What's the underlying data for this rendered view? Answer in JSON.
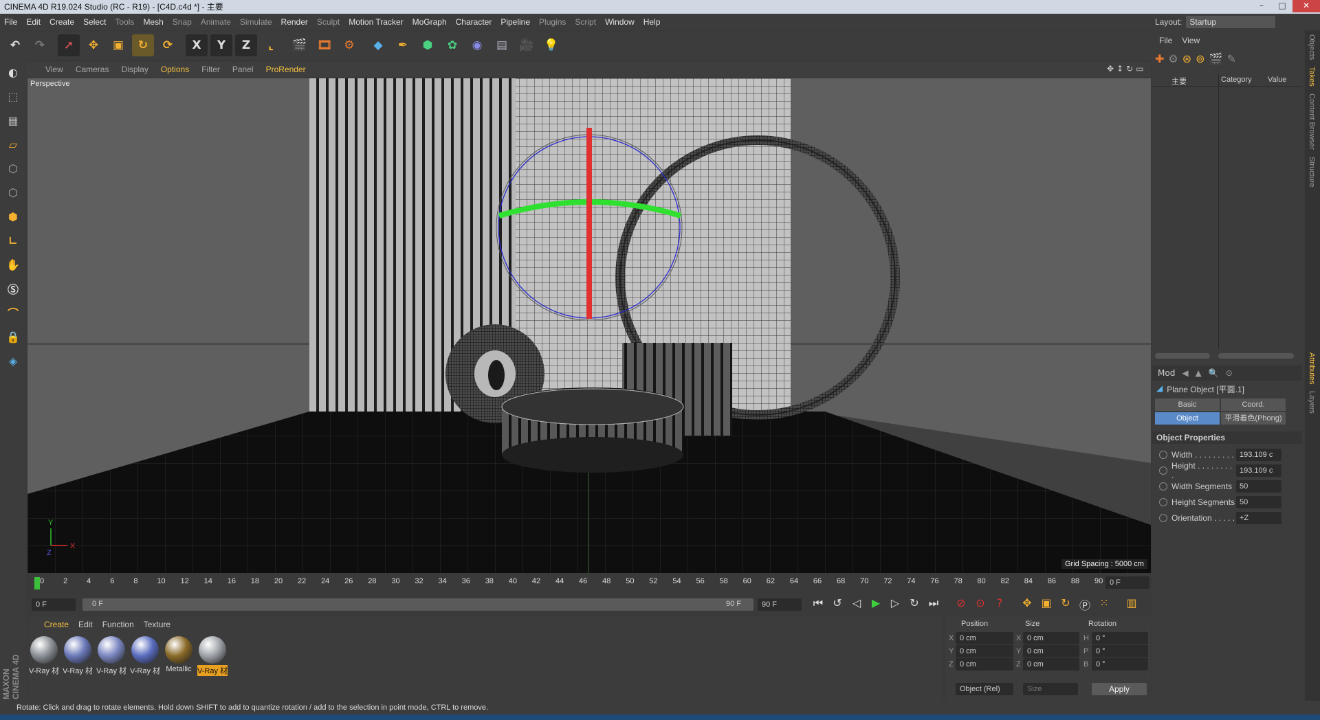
{
  "title_bar": {
    "title": "CINEMA 4D R19.024 Studio (RC - R19) - [C4D.c4d *] - 主要"
  },
  "menu": [
    "File",
    "Edit",
    "Create",
    "Select",
    "Tools",
    "Mesh",
    "Snap",
    "Animate",
    "Simulate",
    "Render",
    "Sculpt",
    "Motion Tracker",
    "MoGraph",
    "Character",
    "Pipeline",
    "Plugins",
    "Script",
    "Window",
    "Help"
  ],
  "layout": {
    "label": "Layout:",
    "value": "Startup"
  },
  "viewport": {
    "menu": [
      "View",
      "Cameras",
      "Display",
      "Options",
      "Filter",
      "Panel",
      "ProRender"
    ],
    "name": "Perspective",
    "grid_spacing": "Grid Spacing : 5000 cm"
  },
  "timeline": {
    "ticks": [
      "0",
      "2",
      "4",
      "6",
      "8",
      "10",
      "12",
      "14",
      "16",
      "18",
      "20",
      "22",
      "24",
      "26",
      "28",
      "30",
      "32",
      "34",
      "36",
      "38",
      "40",
      "42",
      "44",
      "46",
      "48",
      "50",
      "52",
      "54",
      "56",
      "58",
      "60",
      "62",
      "64",
      "66",
      "68",
      "70",
      "72",
      "74",
      "76",
      "78",
      "80",
      "82",
      "84",
      "86",
      "88",
      "90"
    ],
    "current_frame": "0 F",
    "start_frame": "0 F",
    "range_start": "0 F",
    "range_end": "90 F",
    "end_frame": "90 F"
  },
  "materials": {
    "menu": [
      "Create",
      "Edit",
      "Function",
      "Texture"
    ],
    "items": [
      {
        "label": "V-Ray 材",
        "color": "#8a9096"
      },
      {
        "label": "V-Ray 材",
        "color": "#6a78b8"
      },
      {
        "label": "V-Ray 材",
        "color": "#7a86c0"
      },
      {
        "label": "V-Ray 材",
        "color": "#5a6cc0"
      },
      {
        "label": "Metallic",
        "color": "#8a6a28"
      },
      {
        "label": "V-Ray 材",
        "color": "#9ea2a8"
      }
    ]
  },
  "coords": {
    "headers": [
      "Position",
      "Size",
      "Rotation"
    ],
    "rows": [
      {
        "axis": "X",
        "pos": "0 cm",
        "saxis": "X",
        "size": "0 cm",
        "raxis": "H",
        "rot": "0 °"
      },
      {
        "axis": "Y",
        "pos": "0 cm",
        "saxis": "Y",
        "size": "0 cm",
        "raxis": "P",
        "rot": "0 °"
      },
      {
        "axis": "Z",
        "pos": "0 cm",
        "saxis": "Z",
        "size": "0 cm",
        "raxis": "B",
        "rot": "0 °"
      }
    ],
    "mode": "Object (Rel)",
    "size_mode": "Size",
    "apply": "Apply"
  },
  "objects_panel": {
    "menu": [
      "File",
      "View"
    ],
    "tree_item": "主要",
    "columns": [
      "Category",
      "Value"
    ]
  },
  "attributes": {
    "mode": "Mod",
    "object_title": "Plane Object [平面.1]",
    "tabs": [
      "Basic",
      "Coord.",
      "Object",
      "平滑着色(Phong)"
    ],
    "section": "Object Properties",
    "props": [
      {
        "label": "Width . . . . . . . . .",
        "value": "193.109 c"
      },
      {
        "label": "Height . . . . . . . . .",
        "value": "193.109 c"
      },
      {
        "label": "Width Segments",
        "value": "50"
      },
      {
        "label": "Height Segments",
        "value": "50"
      },
      {
        "label": "Orientation . . . . .",
        "value": "+Z"
      }
    ]
  },
  "right_tabs": [
    "Objects",
    "Takes",
    "Content Browser",
    "Structure",
    "Attributes",
    "Layers"
  ],
  "brand": "MAXON CINEMA 4D",
  "status": "Rotate: Click and drag to rotate elements. Hold down SHIFT to add to quantize rotation / add to the selection in point mode, CTRL to remove."
}
